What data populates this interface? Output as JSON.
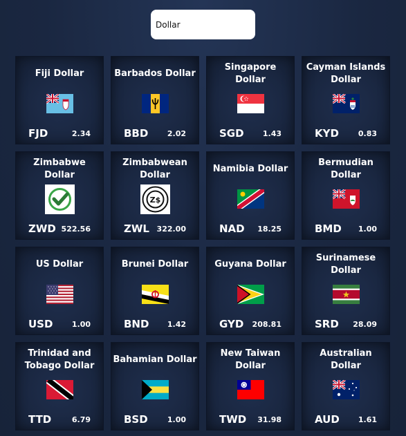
{
  "search": {
    "value": "Dollar",
    "placeholder": ""
  },
  "currencies": [
    {
      "name": "Fiji Dollar",
      "code": "FJD",
      "rate": "2.34",
      "flag": "flag-fiji-icon"
    },
    {
      "name": "Barbados Dollar",
      "code": "BBD",
      "rate": "2.02",
      "flag": "flag-barbados-icon"
    },
    {
      "name": "Singapore Dollar",
      "code": "SGD",
      "rate": "1.43",
      "flag": "flag-singapore-icon"
    },
    {
      "name": "Cayman Islands Dollar",
      "code": "KYD",
      "rate": "0.83",
      "flag": "flag-cayman-islands-icon"
    },
    {
      "name": "Zimbabwe Dollar",
      "code": "ZWD",
      "rate": "522.56",
      "flag": "check-mark-icon"
    },
    {
      "name": "Zimbabwean Dollar",
      "code": "ZWL",
      "rate": "322.00",
      "flag": "zimbabwe-dollar-logo-icon",
      "logo_text": "Z$"
    },
    {
      "name": "Namibia Dollar",
      "code": "NAD",
      "rate": "18.25",
      "flag": "flag-namibia-icon"
    },
    {
      "name": "Bermudian Dollar",
      "code": "BMD",
      "rate": "1.00",
      "flag": "flag-bermuda-icon"
    },
    {
      "name": "US Dollar",
      "code": "USD",
      "rate": "1.00",
      "flag": "flag-usa-icon"
    },
    {
      "name": "Brunei Dollar",
      "code": "BND",
      "rate": "1.42",
      "flag": "flag-brunei-icon"
    },
    {
      "name": "Guyana Dollar",
      "code": "GYD",
      "rate": "208.81",
      "flag": "flag-guyana-icon"
    },
    {
      "name": "Surinamese Dollar",
      "code": "SRD",
      "rate": "28.09",
      "flag": "flag-suriname-icon"
    },
    {
      "name": "Trinidad and Tobago Dollar",
      "code": "TTD",
      "rate": "6.79",
      "flag": "flag-trinidad-tobago-icon"
    },
    {
      "name": "Bahamian Dollar",
      "code": "BSD",
      "rate": "1.00",
      "flag": "flag-bahamas-icon"
    },
    {
      "name": "New Taiwan Dollar",
      "code": "TWD",
      "rate": "31.98",
      "flag": "flag-taiwan-icon"
    },
    {
      "name": "Australian Dollar",
      "code": "AUD",
      "rate": "1.61",
      "flag": "flag-australia-icon"
    }
  ]
}
